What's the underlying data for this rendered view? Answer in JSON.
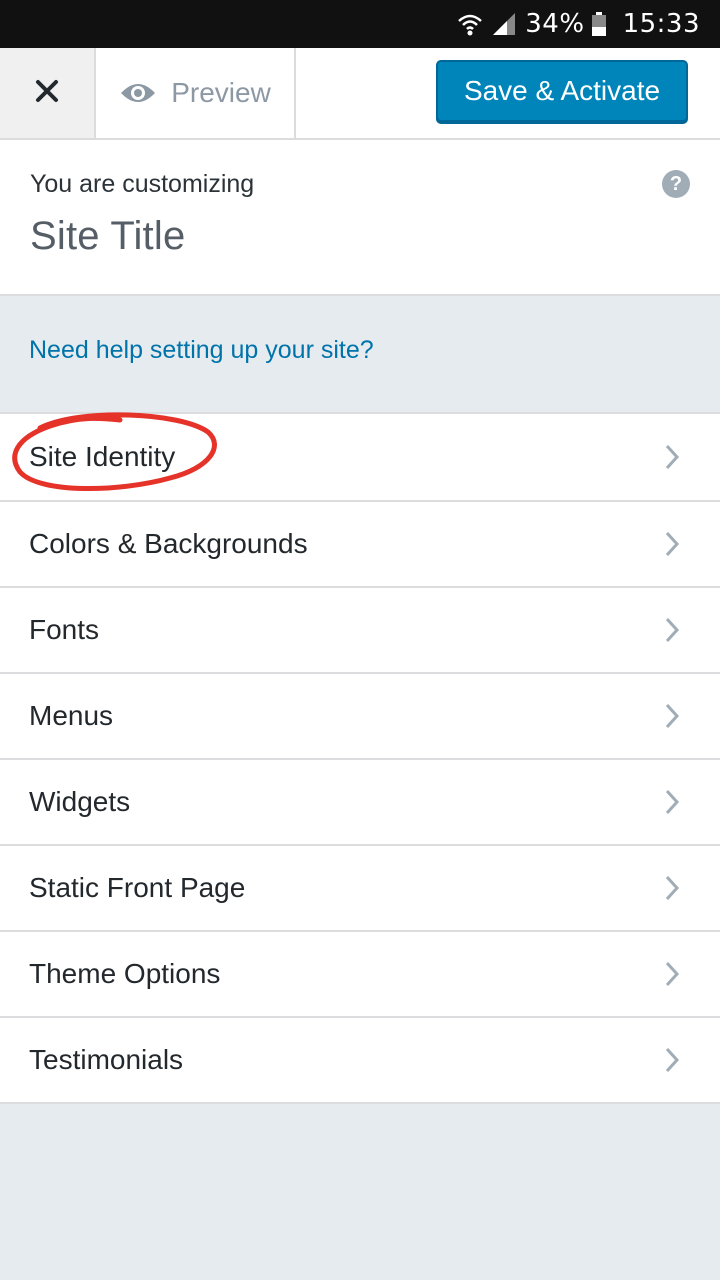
{
  "status_bar": {
    "battery": "34%",
    "time": "15:33",
    "icons": [
      "wifi-icon",
      "signal-icon",
      "battery-icon"
    ]
  },
  "toolbar": {
    "close_icon": "close-icon",
    "preview_label": "Preview",
    "preview_icon": "eye-icon",
    "save_label": "Save & Activate"
  },
  "info": {
    "subtitle": "You are customizing",
    "site_title": "Site Title",
    "help_icon": "question-icon"
  },
  "help_banner": {
    "link_text": "Need help setting up your site?"
  },
  "menu": {
    "items": [
      {
        "label": "Site Identity"
      },
      {
        "label": "Colors & Backgrounds"
      },
      {
        "label": "Fonts"
      },
      {
        "label": "Menus"
      },
      {
        "label": "Widgets"
      },
      {
        "label": "Static Front Page"
      },
      {
        "label": "Theme Options"
      },
      {
        "label": "Testimonials"
      }
    ]
  },
  "colors": {
    "primary_button": "#0085ba",
    "link": "#0073aa",
    "annotation": "#e5332a",
    "panel_background": "#e5ebef"
  }
}
